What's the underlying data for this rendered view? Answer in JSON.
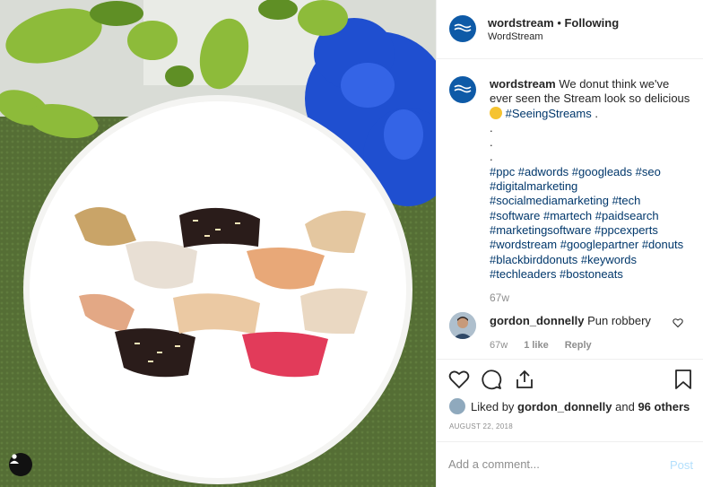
{
  "header": {
    "username": "wordstream",
    "separator": " • ",
    "follow_status": "Following",
    "subtitle": "WordStream"
  },
  "caption": {
    "username": "wordstream",
    "text": "We donut think we've ever seen the Stream look so delicious",
    "inline_tag": "#SeeingStreams",
    "trailing": " .",
    "dots": [
      ".",
      ".",
      "."
    ],
    "hashtags": "#ppc #adwords #googleads #seo #digitalmarketing #socialmediamarketing #tech #software #martech #paidsearch #marketingsoftware #ppcexperts #wordstream #googlepartner #donuts #blackbirddonuts #keywords #techleaders #bostoneats",
    "time": "67w"
  },
  "comment": {
    "username": "gordon_donnelly",
    "text": "Pun robbery",
    "time": "67w",
    "likes": "1 like",
    "reply": "Reply"
  },
  "likes": {
    "prefix": "Liked by ",
    "user": "gordon_donnelly",
    "middle": " and ",
    "others": "96 others"
  },
  "date": "AUGUST 22, 2018",
  "add_comment": {
    "placeholder": "Add a comment...",
    "post_label": "Post"
  },
  "icons": {
    "like": "heart-icon",
    "comment": "comment-icon",
    "share": "share-icon",
    "save": "bookmark-icon",
    "tag": "user-tag-icon"
  },
  "colors": {
    "hashtag": "#00376b",
    "muted": "#8e8e8e",
    "post_disabled": "#b2dffc",
    "brand": "#0e5aa7"
  }
}
